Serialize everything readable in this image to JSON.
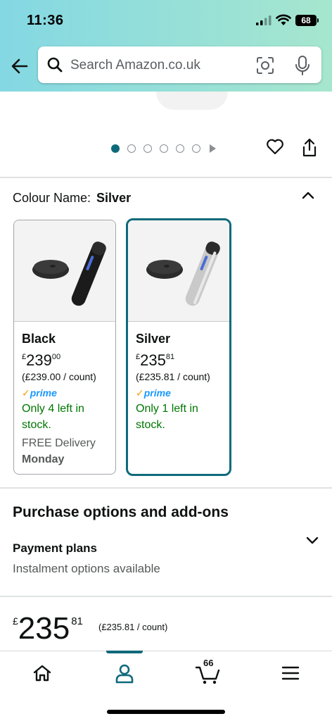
{
  "status_bar": {
    "time": "11:36",
    "battery": "68"
  },
  "search": {
    "placeholder": "Search Amazon.co.uk"
  },
  "carousel": {
    "dots": 6,
    "active": 0
  },
  "colour": {
    "label": "Colour Name:",
    "selected": "Silver",
    "options": [
      {
        "name": "Black",
        "currency": "£",
        "price_whole": "239",
        "price_fraction": "00",
        "unit_price": "(£239.00 / count)",
        "prime": "prime",
        "stock": "Only 4 left in stock.",
        "delivery": "FREE Delivery",
        "delivery_day": "Monday"
      },
      {
        "name": "Silver",
        "currency": "£",
        "price_whole": "235",
        "price_fraction": "81",
        "unit_price": "(£235.81 / count)",
        "prime": "prime",
        "stock": "Only 1 left in stock."
      }
    ]
  },
  "purchase_options": {
    "title": "Purchase options and add-ons",
    "payment_title": "Payment plans",
    "payment_subtitle": "Instalment options available"
  },
  "price_footer": {
    "currency": "£",
    "whole": "235",
    "fraction": "81",
    "unit_price": "(£235.81 / count)"
  },
  "tabbar": {
    "items": [
      "home-icon",
      "account-icon",
      "cart-icon",
      "menu-icon"
    ],
    "active": 1,
    "cart_count": "66"
  },
  "colors": {
    "accent": "#0e6a7a",
    "stock_green": "#007600",
    "prime_blue": "#1a98ff"
  }
}
